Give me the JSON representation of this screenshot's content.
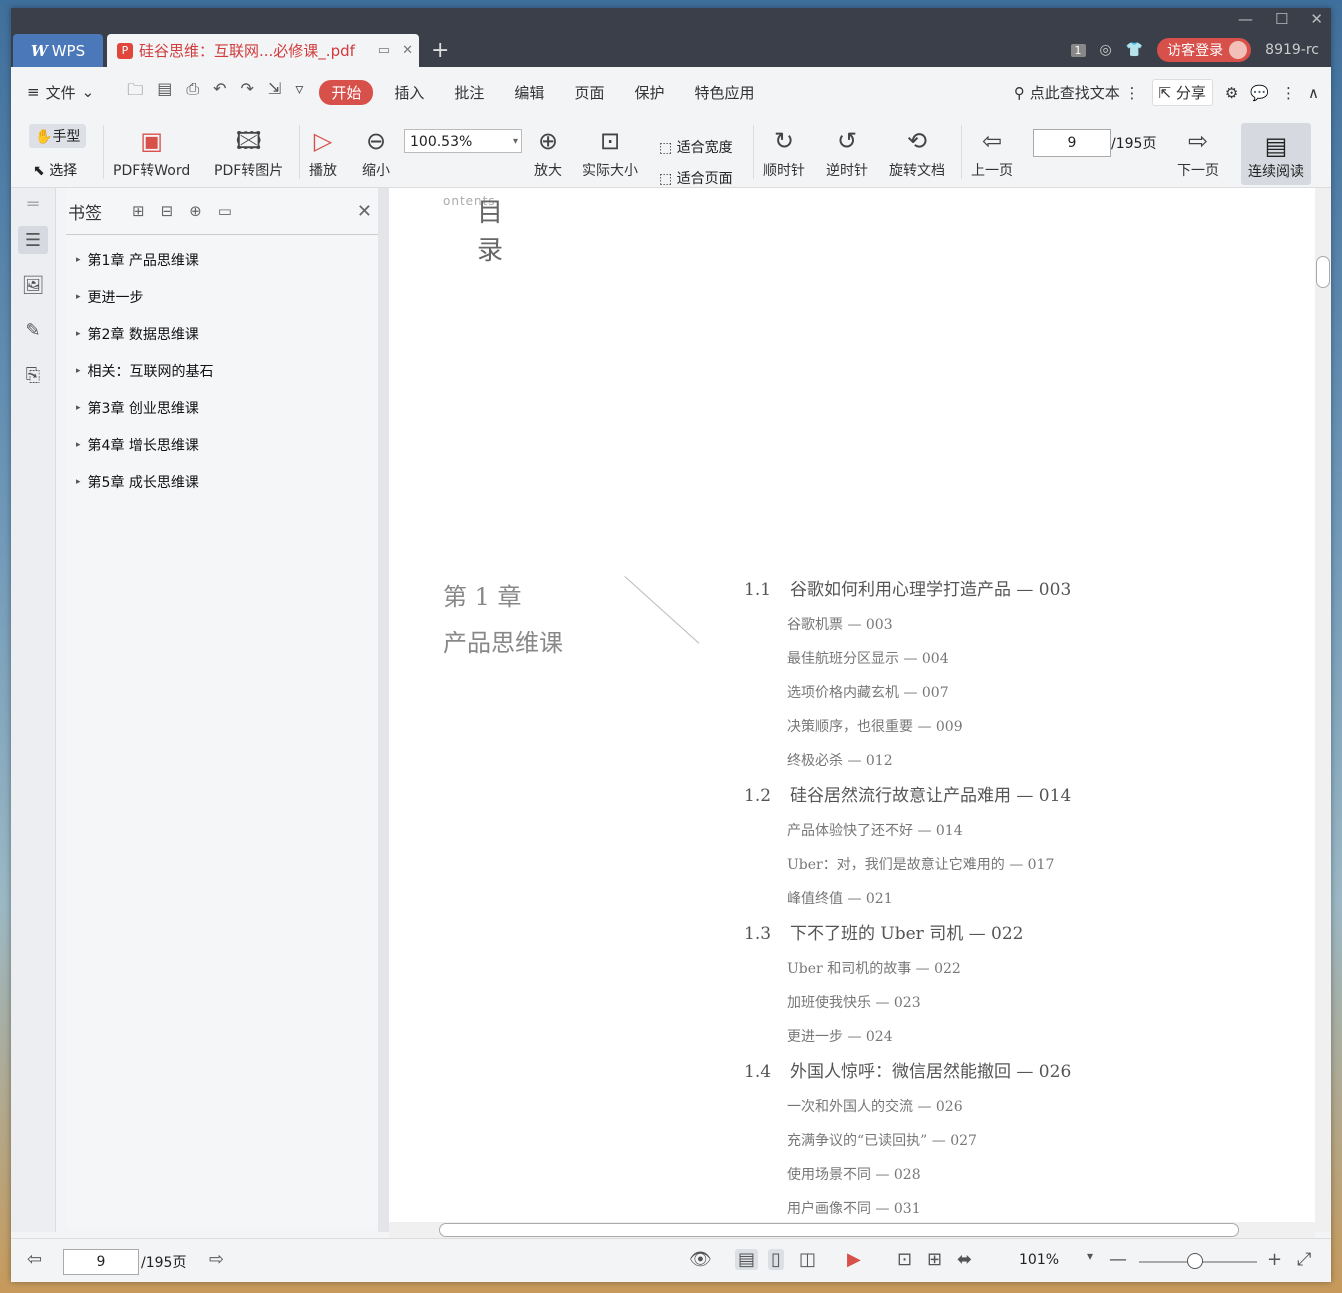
{
  "titlebar": {
    "wps_tab": "WPS",
    "doc_tab": "硅谷思维：互联网...必修课_.pdf",
    "badge": "1",
    "login": "访客登录",
    "version": "8919-rc"
  },
  "menu": {
    "file": "文件",
    "items": [
      "开始",
      "插入",
      "批注",
      "编辑",
      "页面",
      "保护",
      "特色应用"
    ],
    "search": "点此查找文本",
    "share": "分享"
  },
  "toolbar": {
    "hand": "手型",
    "select": "选择",
    "pdf_to_word": "PDF转Word",
    "pdf_to_image": "PDF转图片",
    "play": "播放",
    "zoom_out": "缩小",
    "zoom_value": "100.53%",
    "zoom_in": "放大",
    "actual_size": "实际大小",
    "fit_width": "适合宽度",
    "fit_page": "适合页面",
    "rotate_cw": "顺时针",
    "rotate_ccw": "逆时针",
    "rotate_doc": "旋转文档",
    "prev_page": "上一页",
    "page_value": "9",
    "page_total": "/195页",
    "next_page": "下一页",
    "continuous": "连续阅读"
  },
  "bookmarks": {
    "title": "书签",
    "items": [
      "第1章 产品思维课",
      "更进一步",
      "第2章 数据思维课",
      "相关：互联网的基石",
      "第3章 创业思维课",
      "第4章 增长思维课",
      "第5章 成长思维课"
    ]
  },
  "doc": {
    "mulu": "目录",
    "contents": "ontents",
    "chapter_no": "第 1 章",
    "chapter_title": "产品思维课",
    "toc": [
      {
        "type": "sec",
        "num": "1.2",
        "text": "硅谷居然流行故意让产品难用 — 014"
      }
    ],
    "toc_1_1": "谷歌如何利用心理学打造产品 — 003",
    "toc_lines": [
      {
        "kind": "sec",
        "num": "1.1",
        "text": "谷歌如何利用心理学打造产品 — 003"
      },
      {
        "kind": "sub",
        "text": "谷歌机票 — 003"
      },
      {
        "kind": "sub",
        "text": "最佳航班分区显示 — 004"
      },
      {
        "kind": "sub",
        "text": "选项价格内藏玄机 — 007"
      },
      {
        "kind": "sub",
        "text": "决策顺序，也很重要 — 009"
      },
      {
        "kind": "sub",
        "text": "终极必杀 — 012"
      },
      {
        "kind": "sec",
        "num": "1.2",
        "text": "硅谷居然流行故意让产品难用 — 014"
      },
      {
        "kind": "sub",
        "text": "产品体验快了还不好 — 014"
      },
      {
        "kind": "sub",
        "text": "Uber：对，我们是故意让它难用的 — 017"
      },
      {
        "kind": "sub",
        "text": "峰值终值 — 021"
      },
      {
        "kind": "sec",
        "num": "1.3",
        "text": "下不了班的 Uber 司机 — 022"
      },
      {
        "kind": "sub",
        "text": "Uber 和司机的故事 — 022"
      },
      {
        "kind": "sub",
        "text": "加班使我快乐 — 023"
      },
      {
        "kind": "sub",
        "text": "更进一步 — 024"
      },
      {
        "kind": "sec",
        "num": "1.4",
        "text": "外国人惊呼：微信居然能撤回 — 026"
      },
      {
        "kind": "sub",
        "text": "一次和外国人的交流 — 026"
      },
      {
        "kind": "sub",
        "text": "充满争议的“已读回执” — 027"
      },
      {
        "kind": "sub",
        "text": "使用场景不同 — 028"
      },
      {
        "kind": "sub",
        "text": "用户画像不同 — 031"
      }
    ]
  },
  "status": {
    "page_value": "9",
    "page_total": "/195页",
    "zoom": "101%"
  }
}
